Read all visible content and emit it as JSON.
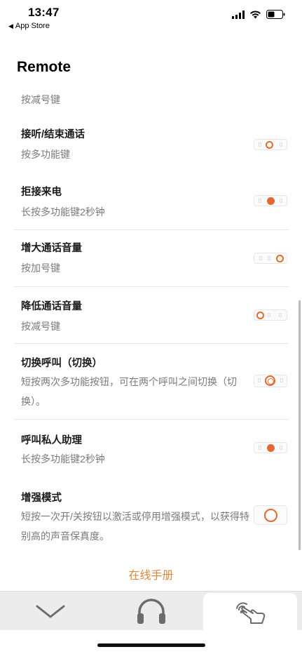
{
  "status_bar": {
    "time": "13:47",
    "back_label": "App Store",
    "back_icon": "back-triangle-icon",
    "icons": [
      "cellular-signal-icon",
      "wifi-icon",
      "battery-icon"
    ]
  },
  "page": {
    "title": "Remote",
    "first_sub": "按减号键"
  },
  "rows": [
    {
      "title": "接听/结束通话",
      "sub": "按多功能键",
      "control": "ring-left"
    },
    {
      "title": "拒接来电",
      "sub": "长按多功能键2秒钟",
      "control": "filled-center"
    },
    {
      "title": "增大通话音量",
      "sub": "按加号键",
      "control": "ring-right"
    },
    {
      "title": "降低通话音量",
      "sub": "按减号键",
      "control": "ring-left"
    },
    {
      "title": "切换呼叫（切换）",
      "sub": "短按两次多功能按钮，可在两个呼叫之间切换（切换）。",
      "control": "double-ring-center"
    },
    {
      "title": "呼叫私人助理",
      "sub": "长按多功能键2秒钟",
      "control": "filled-center"
    },
    {
      "title": "增强模式",
      "sub": "短按一次开/关按钮以激活或停用增强模式，以获得特别高的声音保真度。",
      "control": "big-ring"
    }
  ],
  "manual_link": "在线手册",
  "tabs": [
    {
      "icon": "chevron-down-icon",
      "active": false
    },
    {
      "icon": "headphones-icon",
      "active": false
    },
    {
      "icon": "touch-hand-icon",
      "active": true
    }
  ],
  "colors": {
    "accent": "#e3682f",
    "link": "#d88a3a",
    "subtext": "#7a7a7a",
    "tabbar": "#ececec"
  }
}
